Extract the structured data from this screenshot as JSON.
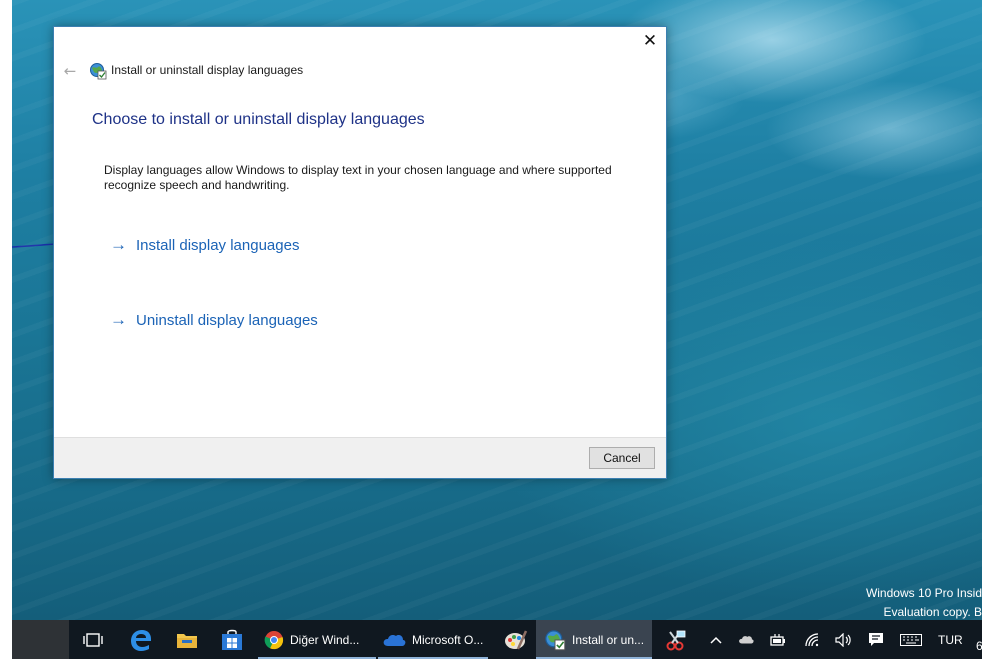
{
  "dialog": {
    "title": "Install or uninstall display languages",
    "close_symbol": "✕",
    "back_symbol": "←",
    "heading": "Choose to install or uninstall display languages",
    "description": "Display languages allow Windows to display text in your chosen language and where supported recognize speech and handwriting.",
    "links": [
      {
        "arrow": "→",
        "label": "Install display languages"
      },
      {
        "arrow": "→",
        "label": "Uninstall display languages"
      }
    ],
    "cancel_label": "Cancel",
    "accent_color": "#1b63b6",
    "heading_color": "#1e3287"
  },
  "desktop": {
    "watermark_line1": "Windows 10 Pro Insid",
    "watermark_line2": "Evaluation copy. B"
  },
  "taskbar": {
    "task_view_icon": "task-view-icon",
    "pinned_icons": [
      "edge-icon",
      "file-explorer-icon",
      "store-icon"
    ],
    "buttons": [
      {
        "icon": "chrome-icon",
        "label": "Diğer Wind..."
      },
      {
        "icon": "onedrive-icon",
        "label": "Microsoft O..."
      },
      {
        "icon": "paint-icon",
        "label": ""
      },
      {
        "icon": "language-settings-icon",
        "label": "Install or un..."
      },
      {
        "icon": "snipping-tool-icon",
        "label": ""
      }
    ],
    "tray": {
      "icons": [
        "chevron-up-icon",
        "onedrive-tray-icon",
        "power-icon",
        "network-icon",
        "volume-icon",
        "action-center-icon",
        "keyboard-icon"
      ],
      "language": "TUR",
      "clock_fragment": "6"
    }
  }
}
